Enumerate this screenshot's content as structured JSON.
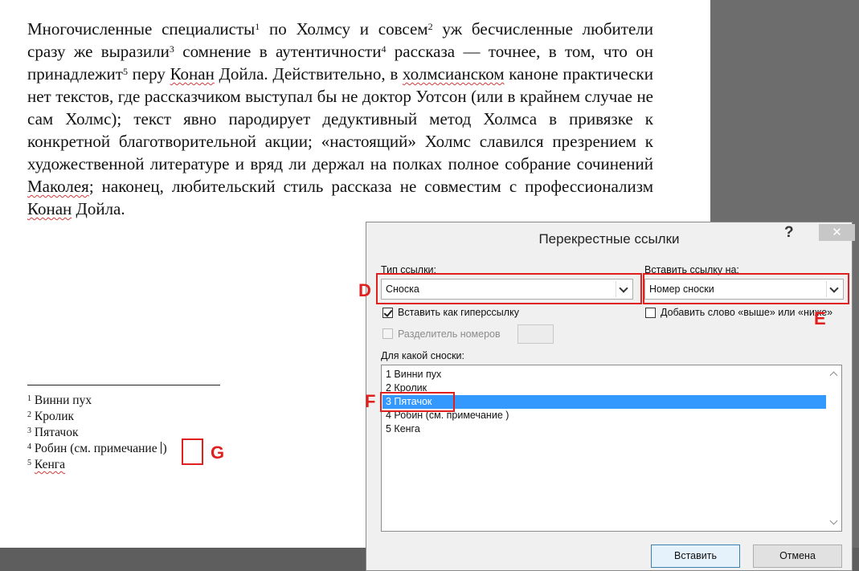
{
  "document": {
    "paragraph": [
      {
        "t": "Многочисленные специалисты"
      },
      {
        "s": "1"
      },
      {
        "t": " по Холмсу и совсем"
      },
      {
        "s": "2"
      },
      {
        "t": " уж бесчисленные любители сразу же выразили"
      },
      {
        "s": "3"
      },
      {
        "t": " сомнение в аутентичности"
      },
      {
        "s": "4"
      },
      {
        "t": " рассказа — точнее, в том, что он принадлежит"
      },
      {
        "s": "5"
      },
      {
        "t": " перу "
      },
      {
        "u": "Конан"
      },
      {
        "t": " Дойла. Действительно, в "
      },
      {
        "u": "холмсианском"
      },
      {
        "t": " каноне практически нет текстов, где рассказчиком выступал бы не доктор Уотсон (или в крайнем случае не сам Холмс); текст явно пародирует дедуктивный метод Холмса в привязке к конкретной благотворительной акции; «настоящий» Холмс славился презрением к художественной литературе и вряд ли держал на полках полное собрание сочинений "
      },
      {
        "u": "Маколея"
      },
      {
        "t": "; наконец, любительский стиль рассказа не совместим с профессионализм "
      },
      {
        "u": "Конан"
      },
      {
        "t": " Дойла."
      }
    ],
    "footnotes": [
      {
        "num": "1",
        "text": "Винни пух"
      },
      {
        "num": "2",
        "text": "Кролик"
      },
      {
        "num": "3",
        "text": "Пятачок"
      },
      {
        "num": "4",
        "text": "Робин (см. примечание ",
        "tail": ")"
      },
      {
        "num": "5",
        "text": "Кенга",
        "spell": true
      }
    ]
  },
  "annotations": {
    "D": "D",
    "E": "E",
    "F": "F",
    "G": "G"
  },
  "dialog": {
    "title": "Перекрестные ссылки",
    "help": "?",
    "close": "✕",
    "ref_type_label": "Тип ссылки:",
    "ref_type_value": "Сноска",
    "insert_ref_label": "Вставить ссылку на:",
    "insert_ref_value": "Номер сноски",
    "hyperlink_label": "Вставить как гиперссылку",
    "hyperlink_checked": true,
    "above_below_label": "Добавить слово «выше» или «ниже»",
    "above_below_checked": false,
    "separator_label": "Разделитель номеров",
    "separator_enabled": false,
    "which_label": "Для какой сноски:",
    "items": [
      {
        "label": "1  Винни пух"
      },
      {
        "label": "2  Кролик"
      },
      {
        "label": "3  Пятачок",
        "selected": true
      },
      {
        "label": "4  Робин (см. примечание  )"
      },
      {
        "label": "5  Кенга"
      }
    ],
    "insert_button": "Вставить",
    "cancel_button": "Отмена"
  },
  "colors": {
    "annotation": "#e0201e",
    "selection": "#3399ff",
    "dialog_bg": "#f0f0f0",
    "workspace": "#6d6d6d"
  }
}
